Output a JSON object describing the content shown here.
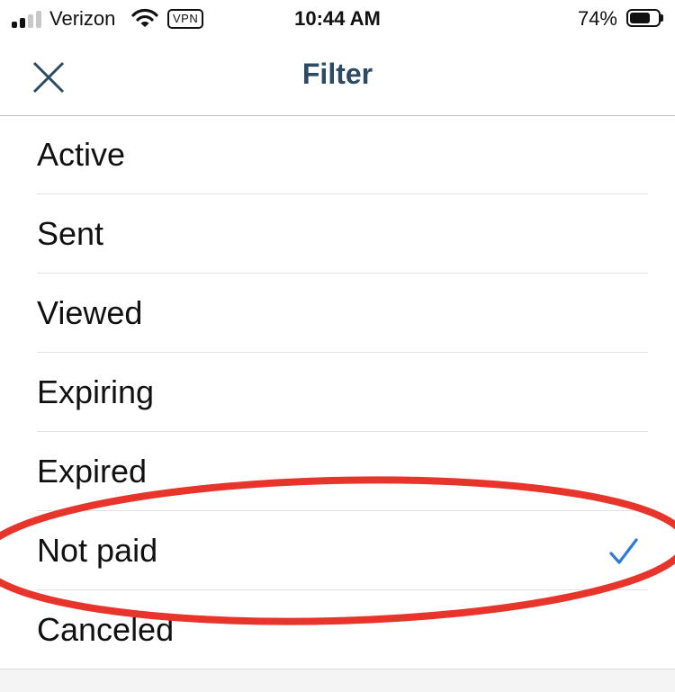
{
  "status_bar": {
    "carrier": "Verizon",
    "vpn_badge": "VPN",
    "time": "10:44 AM",
    "battery_percent": "74%",
    "battery_level": 0.74,
    "signal_bars_active": 2,
    "signal_bars_total": 4
  },
  "nav": {
    "title": "Filter",
    "close_icon": "close-icon"
  },
  "filter_options": [
    {
      "label": "Active",
      "selected": false
    },
    {
      "label": "Sent",
      "selected": false
    },
    {
      "label": "Viewed",
      "selected": false
    },
    {
      "label": "Expiring",
      "selected": false
    },
    {
      "label": "Expired",
      "selected": false
    },
    {
      "label": "Not paid",
      "selected": true
    },
    {
      "label": "Canceled",
      "selected": false
    }
  ],
  "colors": {
    "title": "#2b4a64",
    "checkmark": "#2f7ad9",
    "annotation_ellipse": "#e8352b"
  }
}
